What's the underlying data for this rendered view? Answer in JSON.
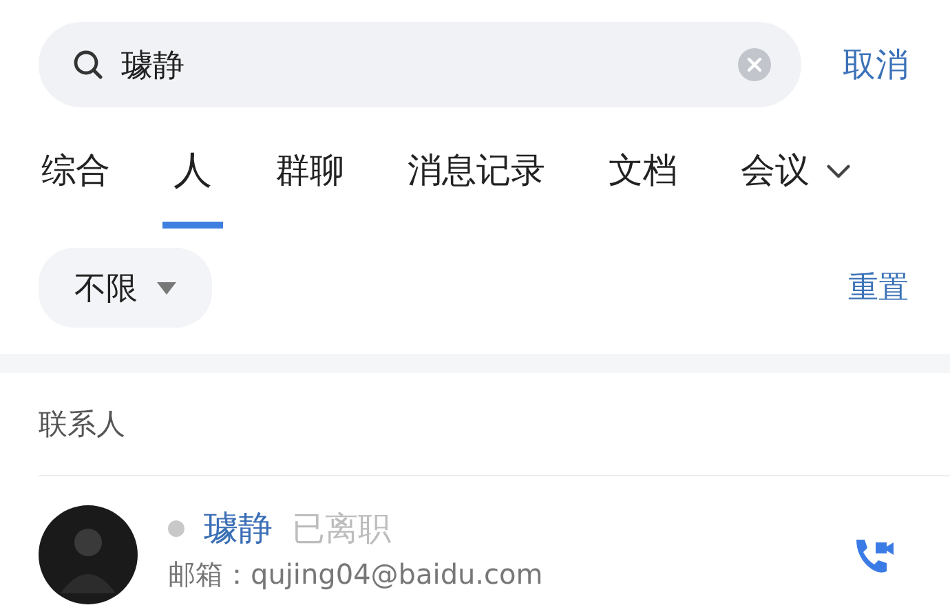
{
  "search": {
    "value": "璩静",
    "cancel": "取消"
  },
  "tabs": [
    {
      "label": "综合",
      "selected": false
    },
    {
      "label": "人",
      "selected": true
    },
    {
      "label": "群聊",
      "selected": false
    },
    {
      "label": "消息记录",
      "selected": false
    },
    {
      "label": "文档",
      "selected": false
    },
    {
      "label": "会议",
      "selected": false
    }
  ],
  "filter": {
    "label": "不限",
    "reset": "重置"
  },
  "section": {
    "title": "联系人"
  },
  "contacts": [
    {
      "name": "璩静",
      "status": "已离职",
      "online": false,
      "email_label": "邮箱：",
      "email": "qujing04@baidu.com"
    }
  ]
}
